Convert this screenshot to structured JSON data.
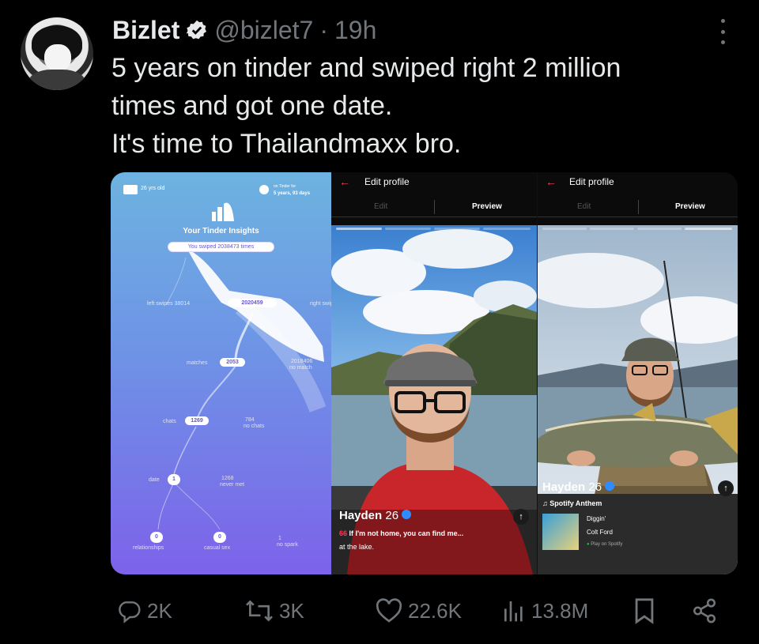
{
  "tweet": {
    "author_name": "Bizlet",
    "handle": "@bizlet7",
    "separator": "·",
    "time": "19h",
    "text_lines": [
      "5 years on tinder and swiped right 2 million",
      "times and got one date.",
      "It's time to Thailandmaxx bro."
    ]
  },
  "insights": {
    "age": "26 yrs old",
    "on_tinder_label": "on Tinder for",
    "on_tinder_value": "5 years, 93 days",
    "title": "Your Tinder Insights",
    "swiped": "You swiped 2038473 times",
    "left_swipes": "left swipes 38014",
    "right_swipes_value": "2020459",
    "right_swipes_label": "right swipes",
    "matches_label": "matches",
    "matches_value": "2053",
    "no_match_value": "2018406",
    "no_match_label": "no match",
    "chats_label": "chats",
    "chats_value": "1269",
    "no_chats_value": "784",
    "no_chats_label": "no chats",
    "date_label": "date",
    "date_value": "1",
    "never_met_value": "1268",
    "never_met_label": "never met",
    "relationships_value": "0",
    "relationships_label": "relationships",
    "casual_value": "0",
    "casual_label": "casual sex",
    "no_spark_value": "1",
    "no_spark_label": "no spark"
  },
  "profile_left": {
    "header": "Edit profile",
    "tab_edit": "Edit",
    "tab_preview": "Preview",
    "name": "Hayden",
    "age": "26",
    "quote_line1": "If I'm not home, you can find me...",
    "quote_line2": "at the lake.",
    "quote_mark": "66"
  },
  "profile_right": {
    "header": "Edit profile",
    "tab_edit": "Edit",
    "tab_preview": "Preview",
    "name": "Hayden",
    "age": "26",
    "anthem_label": "Spotify Anthem",
    "song": "Diggin'",
    "artist": "Colt Ford",
    "play": "Play on Spotify"
  },
  "actions": {
    "replies": "2K",
    "reposts": "3K",
    "likes": "22.6K",
    "views": "13.8M"
  },
  "colors": {
    "background": "#000000",
    "text": "#e7e9ea",
    "muted": "#71767b",
    "verified": "#e7e9ea",
    "tinder_red": "#ff3b5c"
  },
  "icons": [
    "verified-badge-icon",
    "more-icon",
    "reply-icon",
    "repost-icon",
    "like-icon",
    "views-icon",
    "bookmark-icon",
    "share-icon"
  ]
}
